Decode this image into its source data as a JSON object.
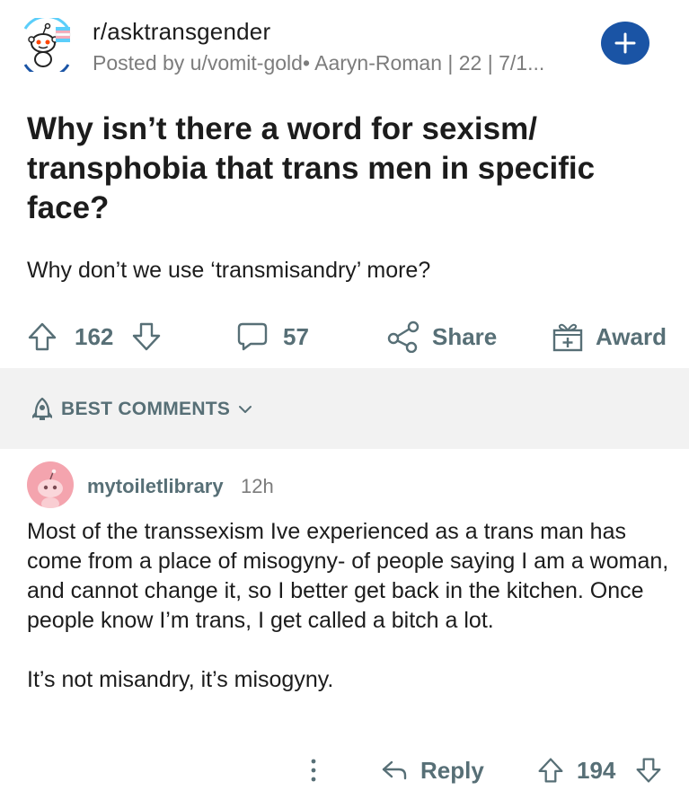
{
  "header": {
    "subreddit": "r/asktransgender",
    "meta": "Posted by u/vomit-gold• Aaryn-Roman | 22 | 7/1...",
    "join_icon": "plus-icon",
    "colors": {
      "join_bg": "#1a54a5",
      "flag_blue": "#5bcefa",
      "flag_pink": "#f5a9b8"
    }
  },
  "post": {
    "title": "Why isn’t there a word for sexism/ transphobia that trans men in specific face?",
    "body": "Why don’t we use ‘transmisandry’ more?"
  },
  "actions": {
    "upvotes": "162",
    "comments": "57",
    "share": "Share",
    "award": "Award",
    "icon_color": "#576f76"
  },
  "sort": {
    "label": "BEST COMMENTS"
  },
  "comment": {
    "author": "mytoiletlibrary",
    "time": "12h",
    "paragraphs": [
      "Most of the transsexism Ive experienced as a trans man has come from a place of misogyny- of people saying I am a woman, and cannot change it, so I better get back in the kitchen. Once people know I’m trans, I get called a bitch a lot.",
      "It’s not misandry, it’s misogyny."
    ],
    "reply": "Reply",
    "votes": "194",
    "avatar_color": "#f4a4ae"
  }
}
